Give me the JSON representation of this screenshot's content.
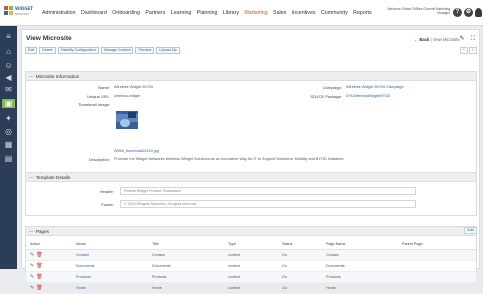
{
  "brand": {
    "name": "WIDGET",
    "sub": "NETWORKS"
  },
  "nav": [
    "Administration",
    "Dashboard",
    "Onboarding",
    "Partners",
    "Learning",
    "Planning",
    "Library",
    "Marketing",
    "Sales",
    "Incentives",
    "Community",
    "Reports"
  ],
  "nav_active": "Marketing",
  "welcome": "Welcome Global CMBee Channel Marketing Manager",
  "page": {
    "title": "View Microsite",
    "back_label": "Back",
    "crumb": "View Microsite"
  },
  "actions": [
    "Edit",
    "Delete",
    "Visibility Configuration",
    "Manage Content",
    "Preview",
    "Upload Zip"
  ],
  "info": {
    "heading": "Microsite Information",
    "name_label": "Name:",
    "name_value": "Wireless Widget BYOD",
    "url_label": "Unique URL:",
    "url_value": "wireless-widget",
    "thumb_label": "Thumbnail Image:",
    "thumb_file": "WWN_thumbnail2x210.jpg",
    "campaign_label": "Campaign:",
    "campaign_value": "Wireless Widget BYOD Campaign",
    "package_label": "SDVCE Package:",
    "package_value": "DYLWirelessWidgetBYOD",
    "desc_label": "Description:",
    "desc_value": "Promote the Widget Networks Wireless Widget Solutions as an Innovative Way for IT to Support Workforce Mobility and BYOD Initiatives"
  },
  "template": {
    "heading": "Template Details",
    "header_label": "Header:",
    "header_value": "Fireball Widget Product Showcases",
    "footer_label": "Footer:",
    "footer_value": "© 2020 Widgets Networks, All rights reserved."
  },
  "pages": {
    "heading": "Pages",
    "add_label": "Add",
    "columns": [
      "Action",
      "Name",
      "Title",
      "Type",
      "Status",
      "Page Name",
      "Parent Page"
    ],
    "rows": [
      [
        "Contact",
        "Contact",
        "content",
        "Go",
        "Contact",
        ""
      ],
      [
        "Documents",
        "Documents",
        "content",
        "Go",
        "Documents",
        ""
      ],
      [
        "Products",
        "Products",
        "content",
        "Go",
        "Products",
        ""
      ],
      [
        "Home",
        "Home",
        "content",
        "Go",
        "Home",
        ""
      ]
    ]
  },
  "colors": {
    "accent": "#e6531d",
    "sidebar": "#2c3e57",
    "link": "#2a5ea8",
    "sidebar_active": "#7fbf3f"
  }
}
